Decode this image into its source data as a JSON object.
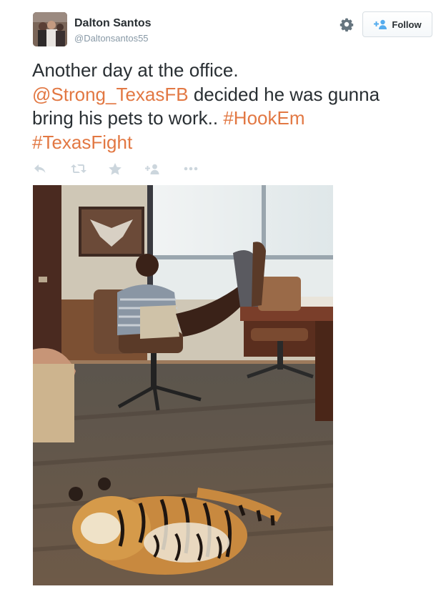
{
  "user": {
    "display_name": "Dalton Santos",
    "handle": "@Daltonsantos55"
  },
  "follow_button": {
    "label": "Follow"
  },
  "tweet": {
    "line1": "Another day at the office.",
    "mention": "@Strong_TexasFB",
    "line2_rest": " decided he was gunna",
    "line3_start": "bring his pets to work.. ",
    "hashtag1": "#HookEm",
    "hashtag2": "#TexasFight"
  },
  "actions": [
    "reply-icon",
    "retweet-icon",
    "favorite-icon",
    "follow-user-icon",
    "more-icon"
  ],
  "colors": {
    "link": "#e27843",
    "text": "#292f33",
    "muted": "#8899a6",
    "icon": "#ccd6dd",
    "follow_icon": "#55acee"
  }
}
